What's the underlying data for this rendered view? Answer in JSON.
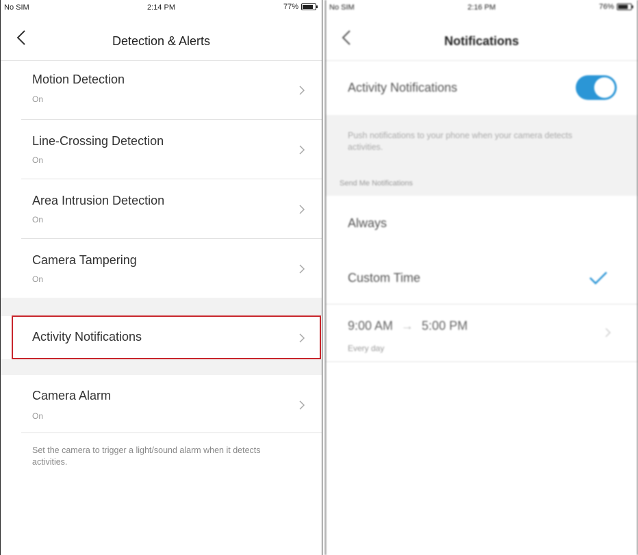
{
  "left_screen": {
    "status_bar": {
      "carrier": "No SIM",
      "time": "2:14 PM",
      "battery": "77%"
    },
    "nav": {
      "title": "Detection & Alerts"
    },
    "items": [
      {
        "label": "Motion Detection",
        "sub": "On"
      },
      {
        "label": "Line-Crossing Detection",
        "sub": "On"
      },
      {
        "label": "Area Intrusion Detection",
        "sub": "On"
      },
      {
        "label": "Camera Tampering",
        "sub": "On"
      }
    ],
    "activity": {
      "label": "Activity Notifications"
    },
    "alarm": {
      "label": "Camera Alarm",
      "sub": "On"
    },
    "alarm_note": "Set the camera to trigger a light/sound alarm when it detects activities.",
    "highlight_color": "#c8262c"
  },
  "right_screen": {
    "status_bar": {
      "carrier": "No SIM",
      "time": "2:16 PM",
      "battery": "76%"
    },
    "nav": {
      "title": "Notifications"
    },
    "activity_toggle": {
      "label": "Activity Notifications",
      "on": true,
      "color": "#2b96d6"
    },
    "push_note": "Push notifications to your phone when your camera detects activities.",
    "section_title": "Send Me Notifications",
    "options": [
      {
        "label": "Always"
      },
      {
        "label": "Custom Time",
        "selected": true
      }
    ],
    "custom_time": {
      "start": "9:00 AM",
      "end": "5:00 PM",
      "repeat": "Every day"
    }
  },
  "icons": {
    "back": "chevron-left-icon",
    "chevron": "chevron-right-icon",
    "check": "checkmark-icon"
  }
}
